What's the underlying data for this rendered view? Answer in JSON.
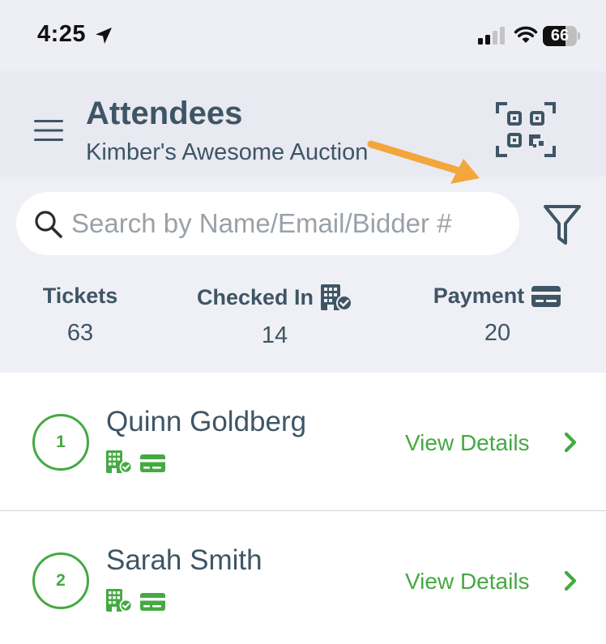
{
  "status_bar": {
    "time": "4:25",
    "battery": "66",
    "battery_level": 0.66
  },
  "header": {
    "title": "Attendees",
    "subtitle": "Kimber's Awesome Auction",
    "menu_icon": "hamburger-menu-icon",
    "qr_icon": "qr-code-scan-icon"
  },
  "search": {
    "placeholder": "Search by Name/Email/Bidder #",
    "value": ""
  },
  "stats": [
    {
      "label": "Tickets",
      "value": "63",
      "icon": ""
    },
    {
      "label": "Checked In",
      "value": "14",
      "icon": "building-check-icon"
    },
    {
      "label": "Payment",
      "value": "20",
      "icon": "credit-card-icon"
    }
  ],
  "attendees": [
    {
      "bidder": "1",
      "name": "Quinn Goldberg",
      "action": "View Details",
      "badges": [
        "building-check-icon",
        "credit-card-icon"
      ]
    },
    {
      "bidder": "2",
      "name": "Sarah Smith",
      "action": "View Details",
      "badges": [
        "building-check-icon",
        "credit-card-icon"
      ]
    }
  ],
  "colors": {
    "accent": "#45a942",
    "text": "#3e5565",
    "header_bg": "#e8e9f1",
    "annotation_arrow": "#f3a63b"
  }
}
